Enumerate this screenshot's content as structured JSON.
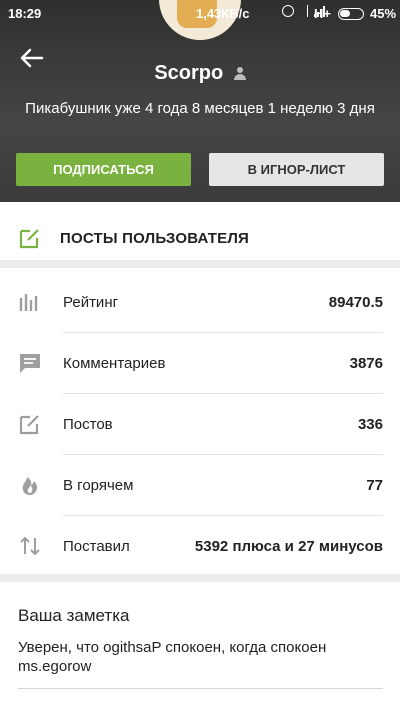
{
  "status_bar": {
    "time": "18:29",
    "speed": "1,43КБ/с",
    "network": "H+",
    "battery": "45%"
  },
  "profile": {
    "username": "Scorpo",
    "since": "Пикабушник уже 4 года 8 месяцев 1 неделю 3 дня",
    "subscribe_label": "ПОДПИСАТЬСЯ",
    "ignore_label": "В ИГНОР-ЛИСТ"
  },
  "posts_link": {
    "label": "ПОСТЫ ПОЛЬЗОВАТЕЛЯ",
    "icon": "edit-icon"
  },
  "stats": [
    {
      "name": "Рейтинг",
      "value": "89470.5",
      "icon": "rating-bars-icon"
    },
    {
      "name": "Комментариев",
      "value": "3876",
      "icon": "comment-icon"
    },
    {
      "name": "Постов",
      "value": "336",
      "icon": "edit-icon"
    },
    {
      "name": "В горячем",
      "value": "77",
      "icon": "flame-icon"
    },
    {
      "name": "Поставил",
      "value": "5392 плюса и 27 минусов",
      "icon": "up-down-arrows-icon"
    }
  ],
  "note": {
    "title": "Ваша заметка",
    "text": "Уверен, что ogithsaP спокоен, когда спокоен ms.egorow"
  },
  "colors": {
    "accent_green": "#7ab23f",
    "header_bg": "#3a3a3a",
    "icon_gray": "#9e9e9e"
  }
}
